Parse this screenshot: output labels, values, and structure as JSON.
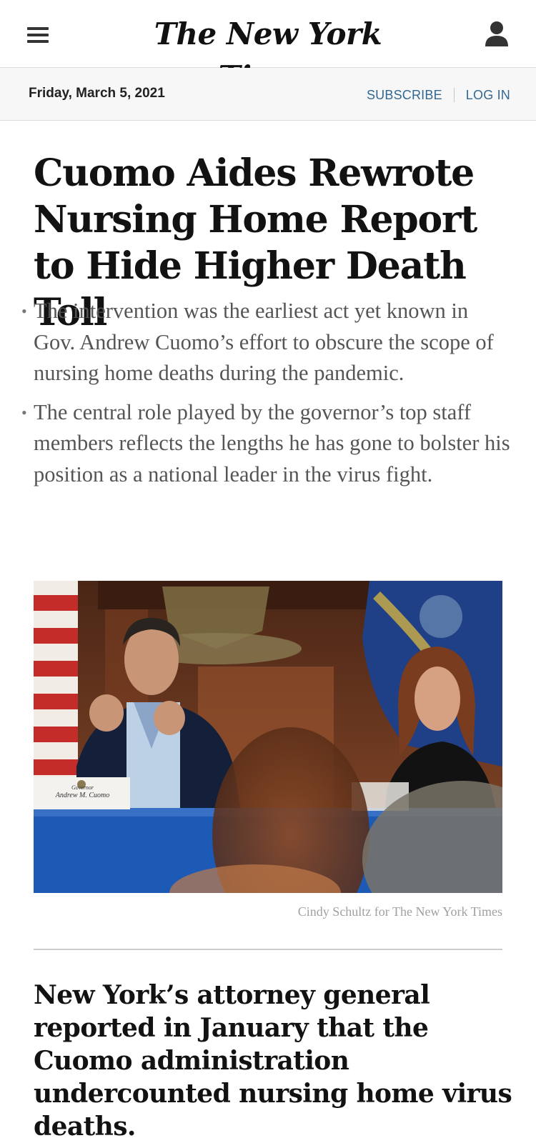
{
  "header": {
    "logo_text": "The New York Times",
    "menu_icon": "hamburger-menu-icon",
    "account_icon": "person-icon"
  },
  "datebar": {
    "date": "Friday, March 5, 2021",
    "subscribe_label": "SUBSCRIBE",
    "login_label": "LOG IN"
  },
  "article": {
    "headline": "Cuomo Aides Rewrote Nursing Home Report to Hide Higher Death Toll",
    "summary": [
      "The intervention was the earliest act yet known in Gov. Andrew Cuomo’s effort to obscure the scope of nursing home deaths during the pandemic.",
      "The central role played by the governor’s top staff members reflects the lengths he has gone to bolster his position as a national leader in the virus fight."
    ],
    "photo": {
      "nameplate_title": "Governor",
      "nameplate_name": "Andrew M. Cuomo",
      "credit": "Cindy Schultz for The New York Times"
    },
    "subhead": "New York’s attorney general reported in January that the Cuomo administration undercounted nursing home virus deaths."
  },
  "colors": {
    "link": "#326891",
    "text": "#121212",
    "summary_text": "#555555",
    "credit": "#a0a0a0"
  }
}
